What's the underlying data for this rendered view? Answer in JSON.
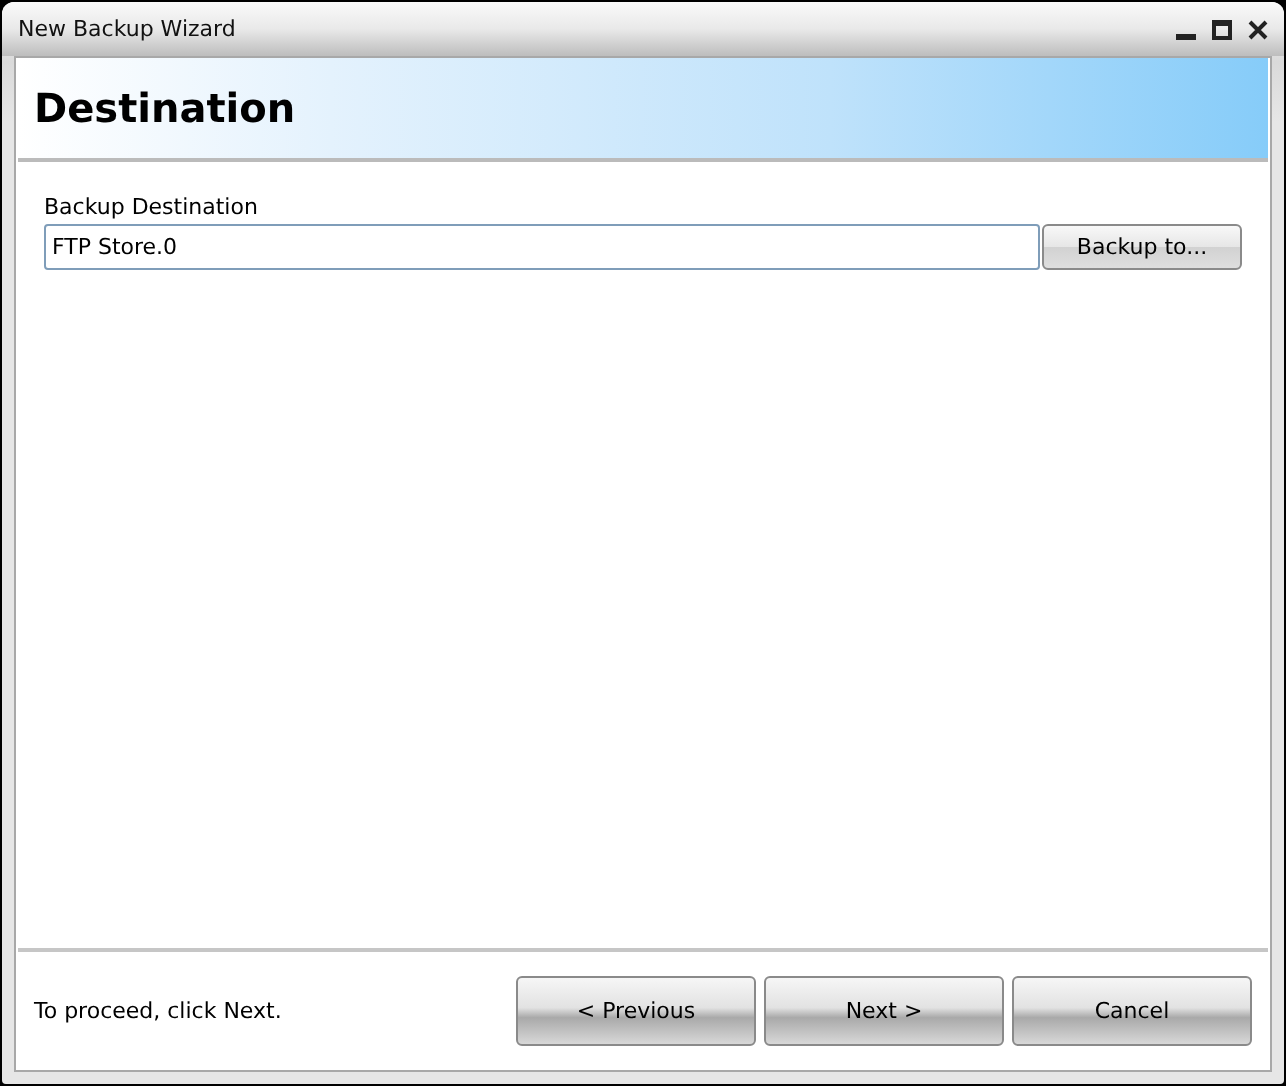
{
  "window": {
    "title": "New Backup Wizard"
  },
  "header": {
    "title": "Destination"
  },
  "destination": {
    "label": "Backup Destination",
    "value": "FTP Store.0",
    "browse_button": "Backup to..."
  },
  "footer": {
    "hint": "To proceed, click Next.",
    "buttons": [
      "< Previous",
      "Next >",
      "Cancel"
    ]
  }
}
